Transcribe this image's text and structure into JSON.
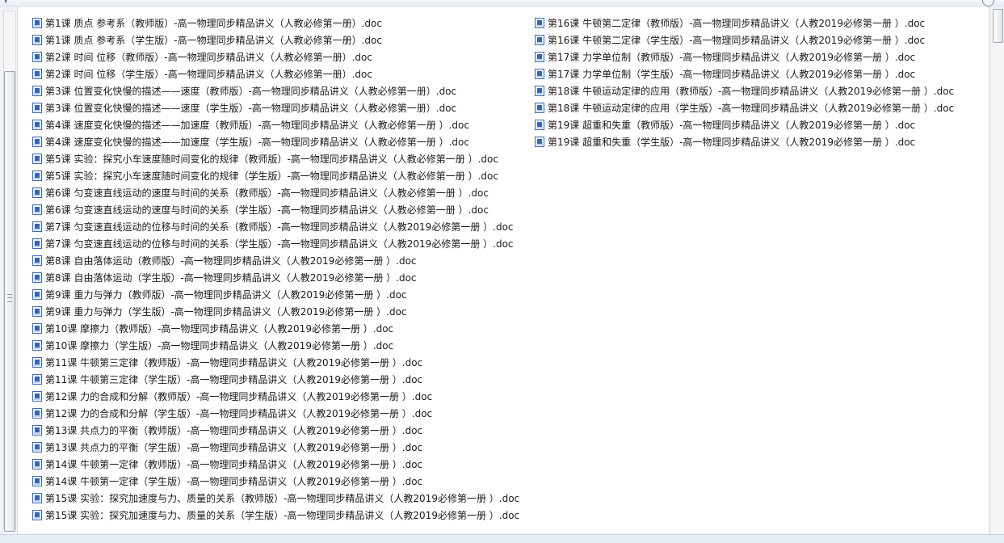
{
  "file_list": {
    "column_1": [
      "第1课 质点 参考系（教师版）-高一物理同步精品讲义（人教必修第一册）.doc",
      "第1课 质点 参考系（学生版）-高一物理同步精品讲义（人教必修第一册）.doc",
      "第2课 时间 位移（教师版）-高一物理同步精品讲义（人教必修第一册）.doc",
      "第2课 时间 位移（学生版）-高一物理同步精品讲义（人教必修第一册）.doc",
      "第3课 位置变化快慢的描述——速度（教师版）-高一物理同步精品讲义（人教必修第一册）.doc",
      "第3课 位置变化快慢的描述——速度（学生版）-高一物理同步精品讲义（人教必修第一册）.doc",
      "第4课 速度变化快慢的描述——加速度（教师版）-高一物理同步精品讲义（人教必修第一册 ）.doc",
      "第4课 速度变化快慢的描述——加速度（学生版）-高一物理同步精品讲义（人教必修第一册 ）.doc",
      "第5课 实验：探究小车速度随时间变化的规律（教师版）-高一物理同步精品讲义（人教必修第一册 ）.doc",
      "第5课 实验：探究小车速度随时间变化的规律（学生版）-高一物理同步精品讲义（人教必修第一册 ）.doc",
      "第6课 匀变速直线运动的速度与时间的关系（教师版）-高一物理同步精品讲义（人教必修第一册 ）.doc",
      "第6课 匀变速直线运动的速度与时间的关系（学生版）-高一物理同步精品讲义（人教必修第一册 ）.doc",
      "第7课 匀变速直线运动的位移与时间的关系（教师版）-高一物理同步精品讲义（人教2019必修第一册 ）.doc",
      "第7课 匀变速直线运动的位移与时间的关系（学生版）-高一物理同步精品讲义（人教2019必修第一册 ）.doc",
      "第8课 自由落体运动（教师版）-高一物理同步精品讲义（人教2019必修第一册 ）.doc",
      "第8课 自由落体运动（学生版）-高一物理同步精品讲义（人教2019必修第一册 ）.doc",
      "第9课 重力与弹力（教师版）-高一物理同步精品讲义（人教2019必修第一册 ）.doc",
      "第9课 重力与弹力（学生版）-高一物理同步精品讲义（人教2019必修第一册 ）.doc",
      "第10课 摩擦力（教师版）-高一物理同步精品讲义（人教2019必修第一册 ）.doc",
      "第10课 摩擦力（学生版）-高一物理同步精品讲义（人教2019必修第一册 ）.doc",
      "第11课 牛顿第三定律（教师版）-高一物理同步精品讲义（人教2019必修第一册 ）.doc",
      "第11课 牛顿第三定律（学生版）-高一物理同步精品讲义（人教2019必修第一册 ）.doc",
      "第12课 力的合成和分解（教师版）-高一物理同步精品讲义（人教2019必修第一册 ）.doc",
      "第12课 力的合成和分解（学生版）-高一物理同步精品讲义（人教2019必修第一册 ）.doc",
      "第13课 共点力的平衡（教师版）-高一物理同步精品讲义（人教2019必修第一册 ）.doc",
      "第13课 共点力的平衡（学生版）-高一物理同步精品讲义（人教2019必修第一册 ）.doc",
      "第14课 牛顿第一定律（教师版）-高一物理同步精品讲义（人教2019必修第一册 ）.doc",
      "第14课 牛顿第一定律（学生版）-高一物理同步精品讲义（人教2019必修第一册 ）.doc",
      "第15课 实验：探究加速度与力、质量的关系（教师版）-高一物理同步精品讲义（人教2019必修第一册 ）.doc",
      "第15课 实验：探究加速度与力、质量的关系（学生版）-高一物理同步精品讲义（人教2019必修第一册 ）.doc"
    ],
    "column_2": [
      "第16课 牛顿第二定律（教师版）-高一物理同步精品讲义（人教2019必修第一册 ）.doc",
      "第16课 牛顿第二定律（学生版）-高一物理同步精品讲义（人教2019必修第一册 ）.doc",
      "第17课 力学单位制（教师版）-高一物理同步精品讲义（人教2019必修第一册 ）.doc",
      "第17课 力学单位制（学生版）-高一物理同步精品讲义（人教2019必修第一册 ）.doc",
      "第18课 牛顿运动定律的应用（教师版）-高一物理同步精品讲义（人教2019必修第一册 ）.doc",
      "第18课 牛顿运动定律的应用（学生版）-高一物理同步精品讲义（人教2019必修第一册 ）.doc",
      "第19课 超重和失重（教师版）-高一物理同步精品讲义（人教2019必修第一册 ）.doc",
      "第19课 超重和失重（学生版）-高一物理同步精品讲义（人教2019必修第一册 ）.doc"
    ],
    "file_icon": "word-document-icon"
  },
  "colors": {
    "list_background": "#ffffff",
    "window_chrome": "#eef2f8",
    "icon_blue": "#2e66c4",
    "text": "#1a1a1a"
  }
}
